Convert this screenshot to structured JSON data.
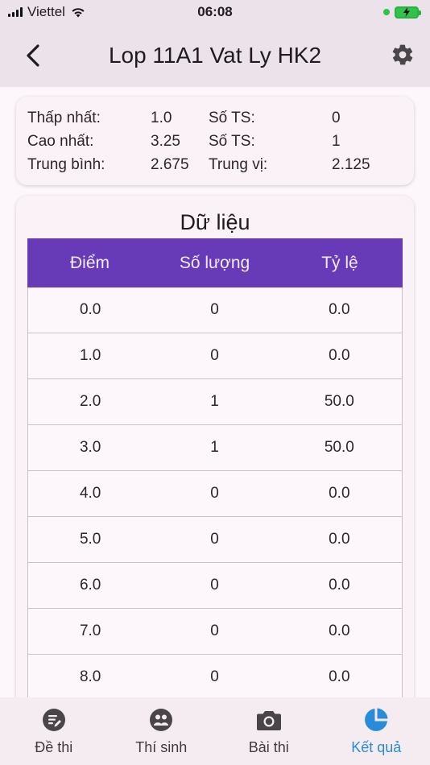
{
  "status_bar": {
    "carrier": "Viettel",
    "time": "06:08"
  },
  "app_bar": {
    "title": "Lop 11A1 Vat Ly HK2"
  },
  "stats": {
    "rows": [
      {
        "label1": "Thấp nhất:",
        "value1": "1.0",
        "label2": "Số TS:",
        "value2": "0"
      },
      {
        "label1": "Cao nhất:",
        "value1": "3.25",
        "label2": "Số TS:",
        "value2": "1"
      },
      {
        "label1": "Trung bình:",
        "value1": "2.675",
        "label2": "Trung vị:",
        "value2": "2.125"
      }
    ]
  },
  "data_section": {
    "title": "Dữ liệu",
    "headers": [
      "Điểm",
      "Số lượng",
      "Tỷ lệ"
    ],
    "rows": [
      [
        "0.0",
        "0",
        "0.0"
      ],
      [
        "1.0",
        "0",
        "0.0"
      ],
      [
        "2.0",
        "1",
        "50.0"
      ],
      [
        "3.0",
        "1",
        "50.0"
      ],
      [
        "4.0",
        "0",
        "0.0"
      ],
      [
        "5.0",
        "0",
        "0.0"
      ],
      [
        "6.0",
        "0",
        "0.0"
      ],
      [
        "7.0",
        "0",
        "0.0"
      ],
      [
        "8.0",
        "0",
        "0.0"
      ]
    ]
  },
  "bottom_nav": {
    "items": [
      {
        "label": "Đề thi",
        "icon": "exam-icon"
      },
      {
        "label": "Thí sinh",
        "icon": "students-icon"
      },
      {
        "label": "Bài thi",
        "icon": "camera-icon"
      },
      {
        "label": "Kết quả",
        "icon": "pie-chart-icon"
      }
    ],
    "active_index": 3
  },
  "colors": {
    "table_header": "#673ab7",
    "active_nav": "#2a8bd8",
    "app_bar_bg": "#ece3ea"
  }
}
